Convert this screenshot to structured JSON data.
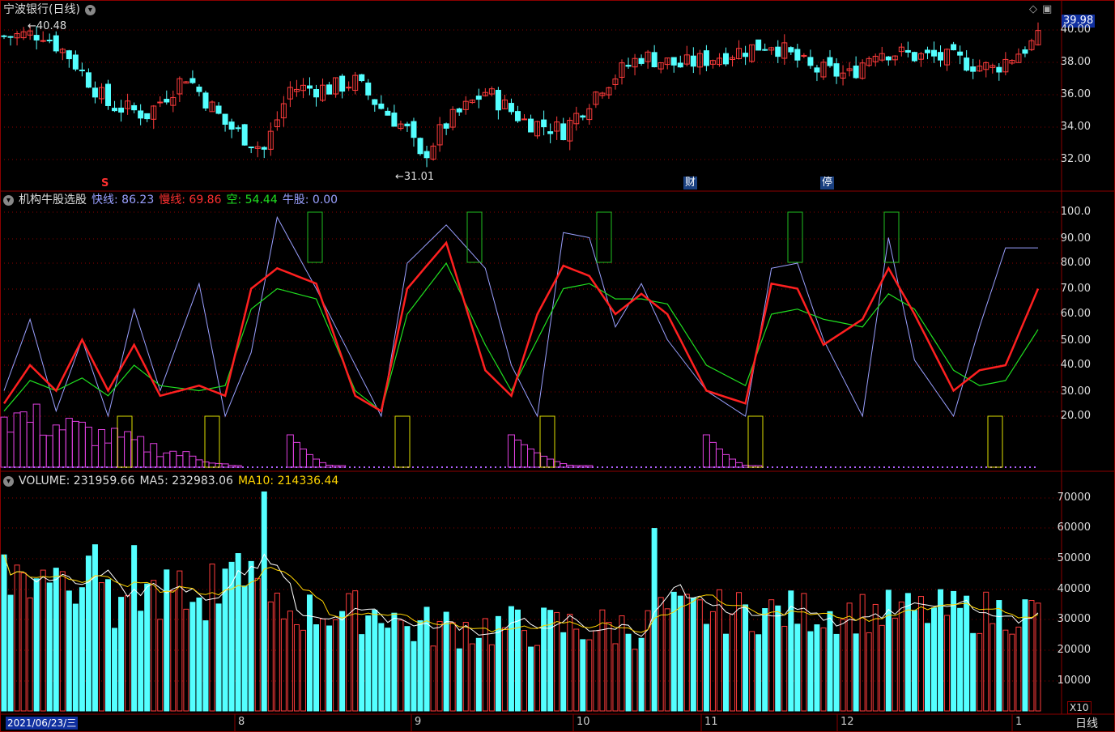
{
  "title": "宁波银行(日线)",
  "price_box": "39.98",
  "price_high_label": "40.48",
  "price_low_label": "31.01",
  "markers": {
    "s": "S",
    "cai": "财",
    "ting": "停"
  },
  "indicator": {
    "name": "机构牛股选股",
    "fast_label": "快线: 86.23",
    "slow_label": "慢线: 69.86",
    "empty_label": "空: 54.44",
    "bull_label": "牛股: 0.00"
  },
  "volume": {
    "label": "VOLUME: 231959.66",
    "ma5_label": "MA5: 232983.06",
    "ma10_label": "MA10: 214336.44",
    "multiplier": "X10"
  },
  "price_axis": [
    "40.00",
    "38.00",
    "36.00",
    "34.00",
    "32.00"
  ],
  "ind_axis": [
    "100.0",
    "90.00",
    "80.00",
    "70.00",
    "60.00",
    "50.00",
    "40.00",
    "30.00",
    "20.00"
  ],
  "vol_axis": [
    "70000",
    "60000",
    "50000",
    "40000",
    "30000",
    "20000",
    "10000"
  ],
  "date_label": "2021/06/23/三",
  "x_labels": [
    "8",
    "9",
    "10",
    "11",
    "12",
    "1"
  ],
  "period": "日线",
  "colors": {
    "up": "#ff3c3c",
    "down": "#54ffff",
    "fast": "#9aa0ff",
    "slow": "#ff2020",
    "empty": "#20e020",
    "ma10": "#ffd400",
    "bull": "#e040e0",
    "grid": "#8b0000"
  },
  "chart_data": {
    "type": "candlestick",
    "series": [
      {
        "name": "price",
        "range": [
          31.01,
          40.48
        ]
      },
      {
        "name": "快线",
        "last": 86.23
      },
      {
        "name": "慢线",
        "last": 69.86
      },
      {
        "name": "空",
        "last": 54.44
      },
      {
        "name": "VOLUME",
        "last": 231959.66
      }
    ]
  }
}
